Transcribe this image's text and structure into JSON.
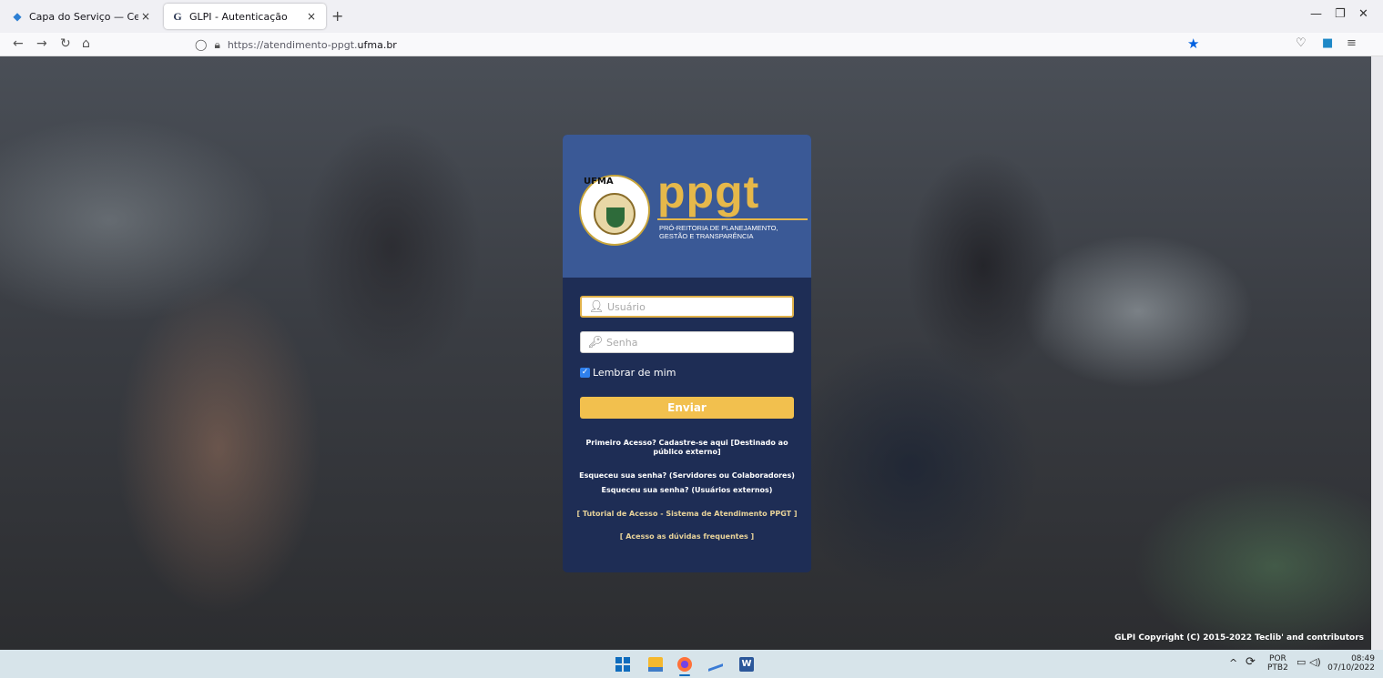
{
  "browser": {
    "tabs": [
      {
        "title": "Capa do Serviço — Central de A",
        "close": "×"
      },
      {
        "title": "GLPI - Autenticação",
        "close": "×"
      }
    ],
    "new_tab": "+",
    "url_prefix": "https://atendimento-ppgt.",
    "url_host": "ufma.br"
  },
  "card": {
    "seal_text": "UFMA",
    "brand": "ppgt",
    "subtitle_line1": "PRÓ-REITORIA DE PLANEJAMENTO,",
    "subtitle_line2": "GESTÃO E TRANSPARÊNCIA",
    "username_placeholder": "Usuário",
    "password_placeholder": "Senha",
    "remember_label": "Lembrar de mim",
    "remember_checked": true,
    "submit_label": "Enviar",
    "first_access_link": "Primeiro Acesso? Cadastre-se aqui [Destinado ao público externo]",
    "forgot_staff_link": "Esqueceu sua senha? (Servidores ou Colaboradores)",
    "forgot_external_link": "Esqueceu sua senha? (Usuários externos)",
    "tutorial_link": "[ Tutorial de Acesso - Sistema de Atendimento PPGT ]",
    "faq_link": "[ Acesso as dúvidas frequentes ]"
  },
  "footer": {
    "copyright": "GLPI Copyright (C) 2015-2022 Teclib' and contributors"
  },
  "taskbar": {
    "lang_top": "POR",
    "lang_bottom": "PTB2",
    "time": "08:49",
    "date": "07/10/2022"
  },
  "colors": {
    "card_header": "#3a5996",
    "card_body": "#1e2d55",
    "accent": "#f2c04e",
    "brand_gold": "#e6b84a"
  }
}
